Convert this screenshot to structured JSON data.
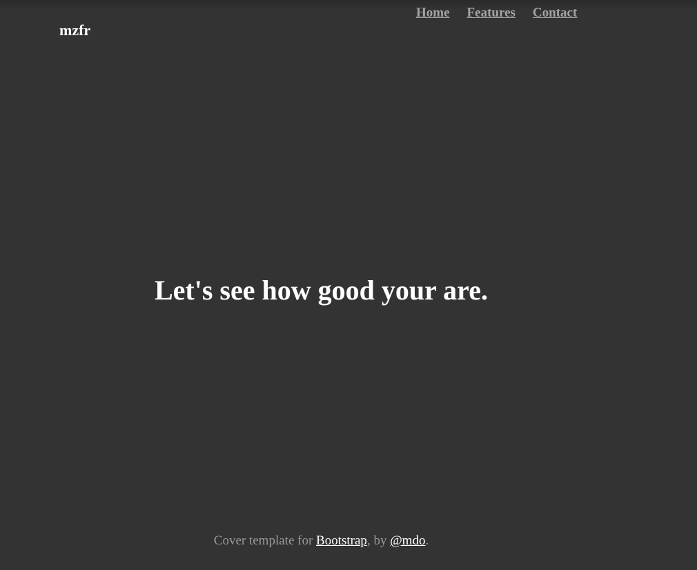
{
  "header": {
    "brand": "mzfr",
    "nav": [
      {
        "label": "Home"
      },
      {
        "label": "Features"
      },
      {
        "label": "Contact"
      }
    ]
  },
  "main": {
    "headline": "Let's see how good your are."
  },
  "footer": {
    "text_before": "Cover template for ",
    "link1": "Bootstrap",
    "text_middle": ", by ",
    "link2": "@mdo",
    "text_after": "."
  },
  "colors": {
    "background": "#333333",
    "text": "#ffffff",
    "muted": "#a3a3a3"
  }
}
